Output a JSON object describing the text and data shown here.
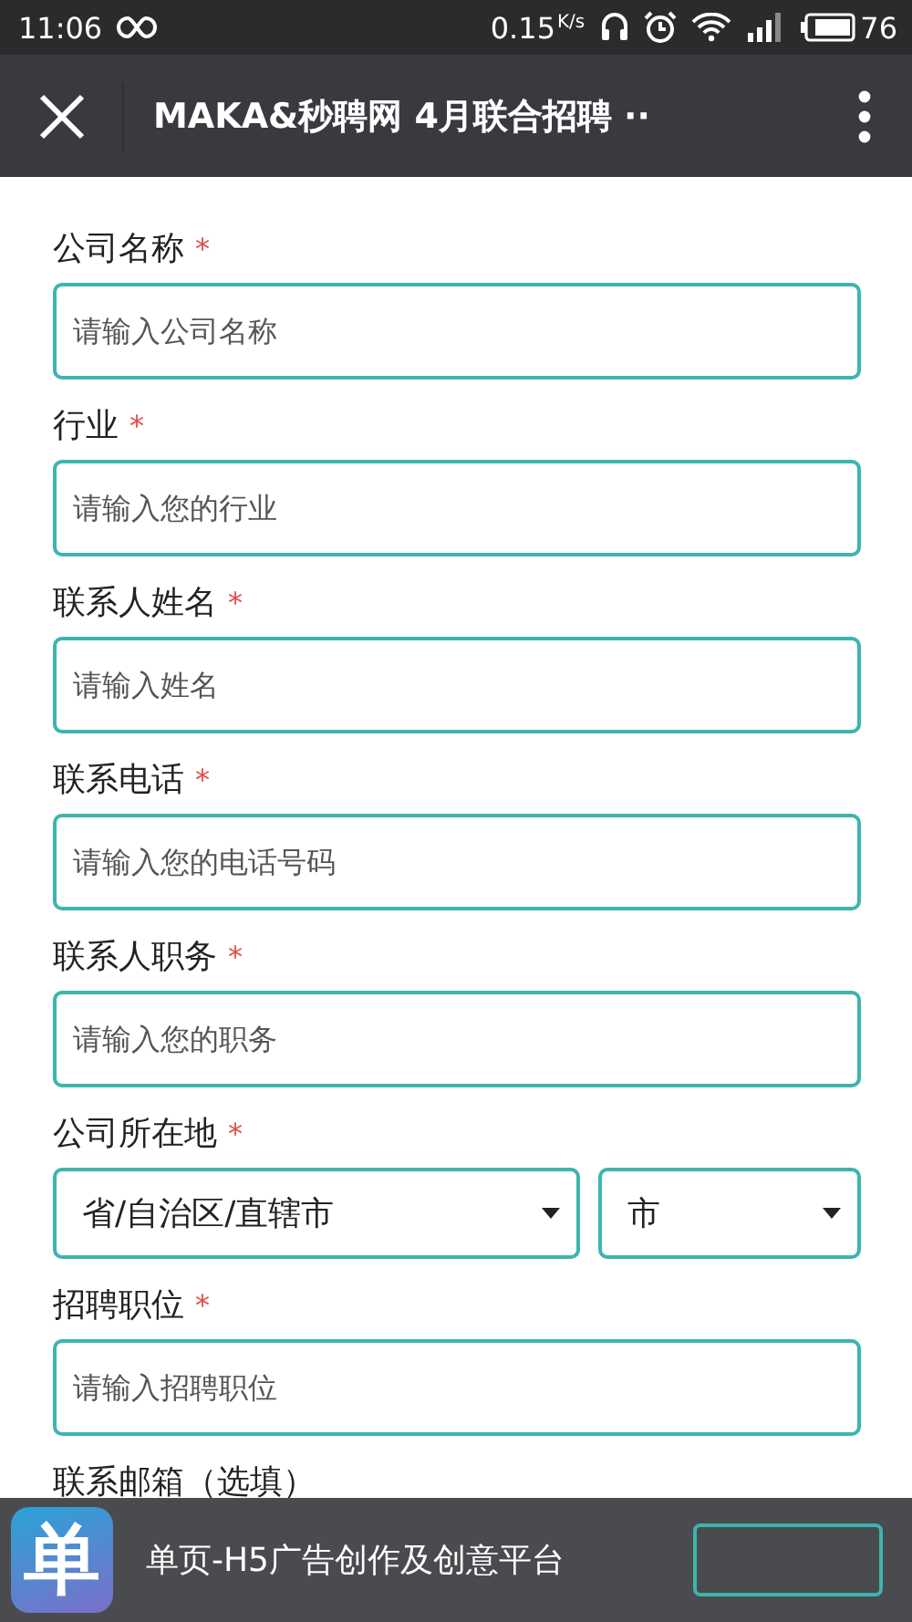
{
  "status_bar": {
    "time": "11:06",
    "speed": "0.15",
    "speed_unit": "K/s",
    "battery": "76"
  },
  "title_bar": {
    "title": "MAKA&秒聘网 4月联合招聘 ··"
  },
  "form": {
    "fields": [
      {
        "kind": "input",
        "label": "公司名称",
        "required": true,
        "placeholder": "请输入公司名称"
      },
      {
        "kind": "input",
        "label": "行业",
        "required": true,
        "placeholder": "请输入您的行业"
      },
      {
        "kind": "input",
        "label": "联系人姓名",
        "required": true,
        "placeholder": "请输入姓名"
      },
      {
        "kind": "input",
        "label": "联系电话",
        "required": true,
        "placeholder": "请输入您的电话号码"
      },
      {
        "kind": "input",
        "label": "联系人职务",
        "required": true,
        "placeholder": "请输入您的职务"
      },
      {
        "kind": "selects",
        "label": "公司所在地",
        "required": true,
        "options": [
          "省/自治区/直辖市",
          "市"
        ]
      },
      {
        "kind": "input",
        "label": "招聘职位",
        "required": true,
        "placeholder": "请输入招聘职位"
      },
      {
        "kind": "input",
        "label": "联系邮箱（选填）",
        "required": false
      }
    ],
    "required_mark": "*"
  },
  "banner": {
    "logo_text": "单",
    "text": "单页-H5广告创作及创意平台"
  }
}
